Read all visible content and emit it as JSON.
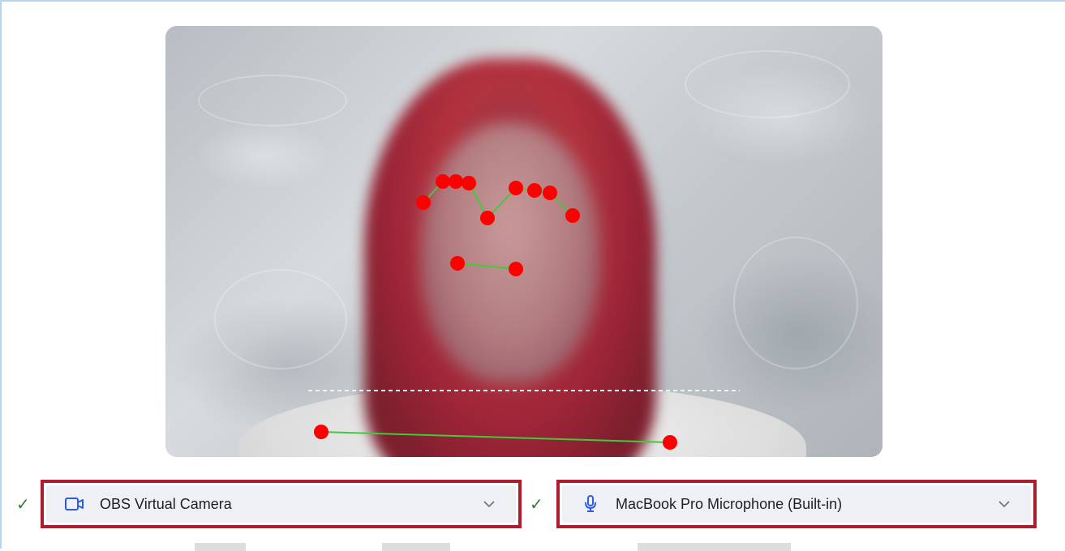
{
  "camera_select": {
    "value": "OBS Virtual Camera",
    "icon": "video-camera-icon",
    "status_icon": "checkmark-icon"
  },
  "microphone_select": {
    "value": "MacBook Pro Microphone (Built-in)",
    "icon": "microphone-icon",
    "status_icon": "checkmark-icon"
  },
  "colors": {
    "highlight_border": "#b01c2e",
    "landmark_point": "#ff0000",
    "landmark_line": "#3ecb3e",
    "check": "#2e7d32",
    "icon_accent": "#2f5be0"
  }
}
